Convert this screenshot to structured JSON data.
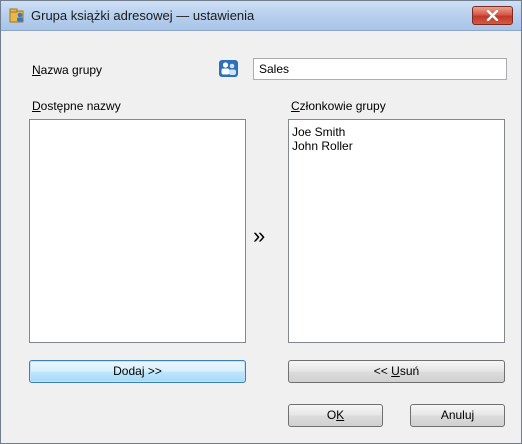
{
  "window": {
    "title": "Grupa książki adresowej — ustawienia"
  },
  "group_name": {
    "label_accel": "N",
    "label_rest": "azwa grupy",
    "value": "Sales"
  },
  "available": {
    "label_accel": "D",
    "label_rest": "ostępne nazwy",
    "items": []
  },
  "members": {
    "label_accel": "C",
    "label_rest": "złonkowie grupy",
    "items": [
      "Joe Smith",
      "John Roller"
    ]
  },
  "transfer_indicator": "»",
  "buttons": {
    "add": "Dodaj >>",
    "remove_prefix": "<< ",
    "remove_accel": "U",
    "remove_rest": "suń",
    "ok_prefix": "O",
    "ok_accel": "K",
    "cancel_prefix": "Anulu",
    "cancel_accel": "j"
  },
  "colors": {
    "titlebar": "#b9d1ee",
    "close_button": "#c0392b",
    "focused_button": "#bee6fd"
  }
}
